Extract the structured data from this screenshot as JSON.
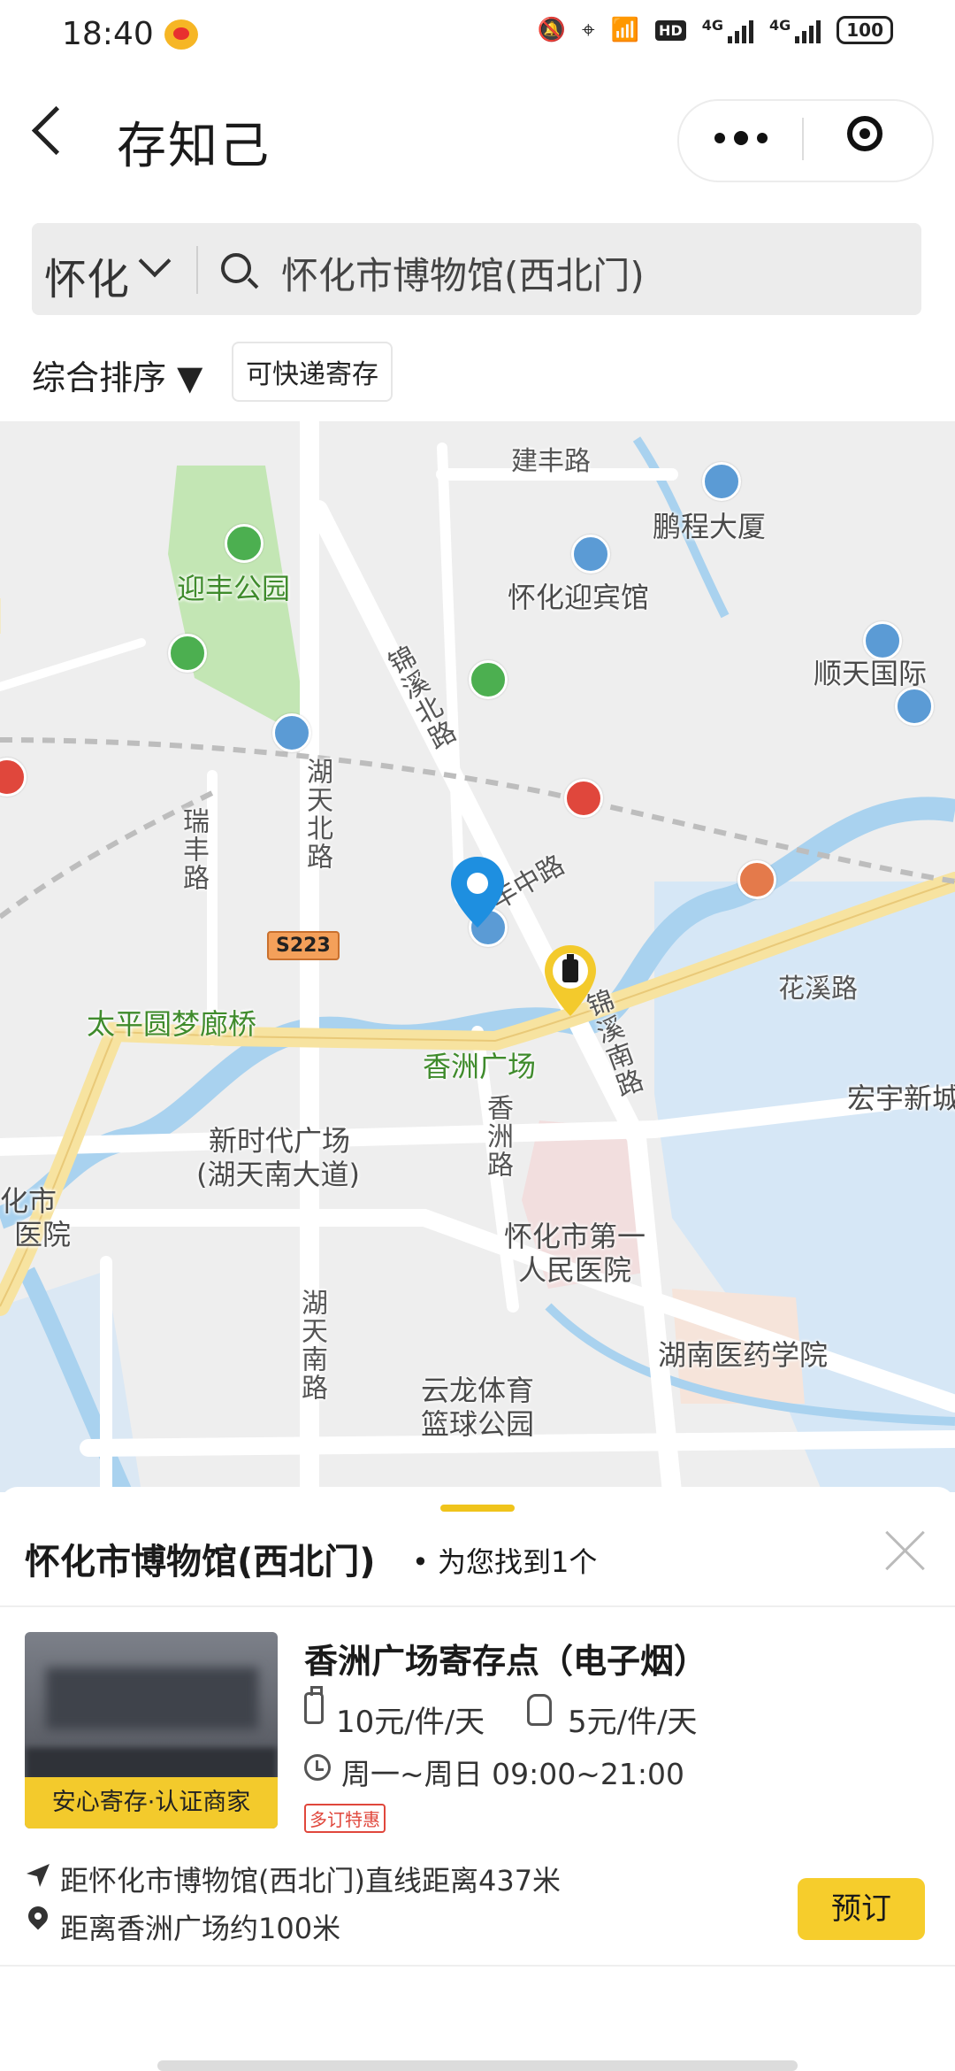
{
  "status_bar": {
    "time": "18:40",
    "hd_label": "HD",
    "net1": "4G",
    "net2": "4G",
    "battery": "100"
  },
  "header": {
    "title": "存知己"
  },
  "search": {
    "city": "怀化",
    "query": "怀化市博物馆(西北门)"
  },
  "filters": {
    "sort_label": "综合排序 ▼",
    "chip_label": "可快递寄存"
  },
  "map": {
    "labels": {
      "jianfeng_road": "建丰路",
      "pengcheng": "鹏程大厦",
      "yingfeng_park": "迎丰公园",
      "yingbin": "怀化迎宾馆",
      "shuntian": "顺天国际",
      "jinxi_north": "锦溪北路",
      "hutian_north": "湖天北路",
      "ruifeng": "瑞丰路",
      "yingfeng_mid": "迎丰中路",
      "route_shield": "S223",
      "taiping": "太平圆梦廊桥",
      "xiangzhou_square": "香洲广场",
      "huaxi": "花溪路",
      "jinxi_south": "锦溪南路",
      "hongyu": "宏宇新城",
      "xinshidai_1": "新时代广场",
      "xinshidai_2": "(湖天南大道)",
      "xiangzhou_road": "香洲路",
      "hospital_left_1": "化市",
      "hospital_left_2": "医院",
      "first_hospital_1": "怀化市第一",
      "first_hospital_2": "人民医院",
      "hutian_south": "湖天南路",
      "medical_college": "湖南医药学院",
      "yunlong_1": "云龙体育",
      "yunlong_2": "篮球公园"
    }
  },
  "results": {
    "place": "怀化市博物馆(西北门)",
    "count_text": "• 为您找到1个",
    "store": {
      "badge": "安心寄存·认证商家",
      "name": "香洲广场寄存点（电子烟）",
      "price_luggage": "10元/件/天",
      "price_bag": "5元/件/天",
      "hours": "周一~周日 09:00~21:00",
      "promo": "多订特惠",
      "distance_line": "距怀化市博物馆(西北门)直线距离437米",
      "nearby_line": "距离香洲广场约100米",
      "book_label": "预订"
    }
  },
  "colors": {
    "accent_yellow": "#f6cd2c",
    "pin_blue": "#1e8fe0",
    "water": "#a9d2ef",
    "park_green": "#c3e6b4"
  }
}
